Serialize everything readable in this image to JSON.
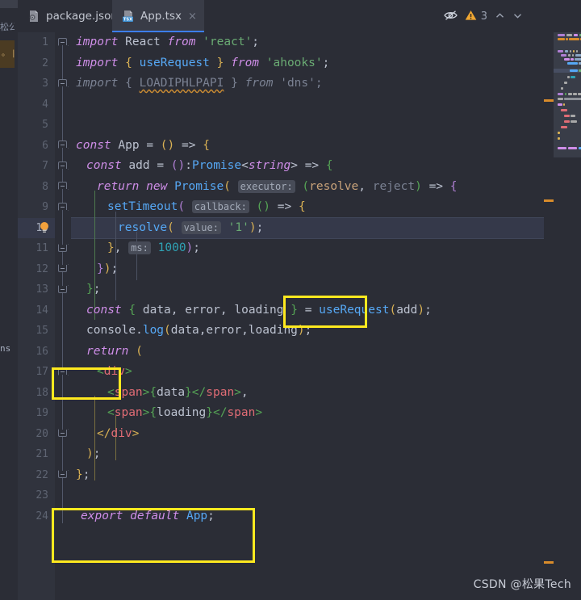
{
  "window": {
    "title": "App.tsx",
    "theme_background": "#2b2d36",
    "accent": "#3d7ef0",
    "annotation_color": "#ffe91f"
  },
  "left_sliver": {
    "fragment_top": "松公",
    "fragment_mid": "。 |",
    "fragment_bottom": "ns"
  },
  "tabs": [
    {
      "label": "package.json",
      "icon": "json-file-icon",
      "close": "×",
      "active": false
    },
    {
      "label": "App.tsx",
      "icon": "tsx-file-icon",
      "icon_badge": "TSX",
      "close": "×",
      "active": true
    }
  ],
  "inspection": {
    "eye_icon": "eye-off-icon",
    "warning_icon": "warning-triangle-icon",
    "warning_count": "3",
    "prev_icon": "chevron-up-icon",
    "next_icon": "chevron-down-icon"
  },
  "editor": {
    "current_line": 10,
    "line_numbers": [
      1,
      2,
      3,
      4,
      5,
      6,
      7,
      8,
      9,
      10,
      11,
      12,
      13,
      14,
      15,
      16,
      17,
      18,
      19,
      20,
      21,
      22,
      23,
      24
    ],
    "lines": [
      {
        "n": 1,
        "text": "import React from 'react';"
      },
      {
        "n": 2,
        "text": "import { useRequest } from 'ahooks';"
      },
      {
        "n": 3,
        "text": "import { LOADIPHLPAPI } from 'dns';"
      },
      {
        "n": 4,
        "text": ""
      },
      {
        "n": 5,
        "text": ""
      },
      {
        "n": 6,
        "text": "const App = () => {"
      },
      {
        "n": 7,
        "text": "  const add = ():Promise<string> => {"
      },
      {
        "n": 8,
        "text": "    return new Promise( executor: (resolve, reject) => {"
      },
      {
        "n": 9,
        "text": "      setTimeout( callback: () => {"
      },
      {
        "n": 10,
        "text": "        resolve( value: '1');"
      },
      {
        "n": 11,
        "text": "      }, ms: 1000);"
      },
      {
        "n": 12,
        "text": "    });"
      },
      {
        "n": 13,
        "text": "  };"
      },
      {
        "n": 14,
        "text": "  const { data, error, loading } = useRequest(add);"
      },
      {
        "n": 15,
        "text": "  console.log(data,error,loading);"
      },
      {
        "n": 16,
        "text": "  return ("
      },
      {
        "n": 17,
        "text": "    <div>"
      },
      {
        "n": 18,
        "text": "      <span>{data}</span>,"
      },
      {
        "n": 19,
        "text": "      <span>{loading}</span>"
      },
      {
        "n": 20,
        "text": "    </div>"
      },
      {
        "n": 21,
        "text": "  );"
      },
      {
        "n": 22,
        "text": "};"
      },
      {
        "n": 23,
        "text": ""
      },
      {
        "n": 24,
        "text": "export default App;"
      }
    ],
    "parameter_hints": [
      {
        "line": 8,
        "label": "executor:"
      },
      {
        "line": 9,
        "label": "callback:"
      },
      {
        "line": 10,
        "label": "value:"
      },
      {
        "line": 11,
        "label": "ms:"
      }
    ],
    "unused_import": "LOADIPHLPAPI",
    "quick_fix_icon": "lightbulb-icon",
    "quick_fix_line": 10
  },
  "annotations": [
    {
      "id": "box-userequest",
      "target": "useRequest(add)",
      "line": 14
    },
    {
      "id": "box-div",
      "target": "<div>",
      "line": 17
    },
    {
      "id": "box-export",
      "target": "export default App;",
      "line": 24
    }
  ],
  "watermark": {
    "text": "CSDN @松果Tech"
  }
}
